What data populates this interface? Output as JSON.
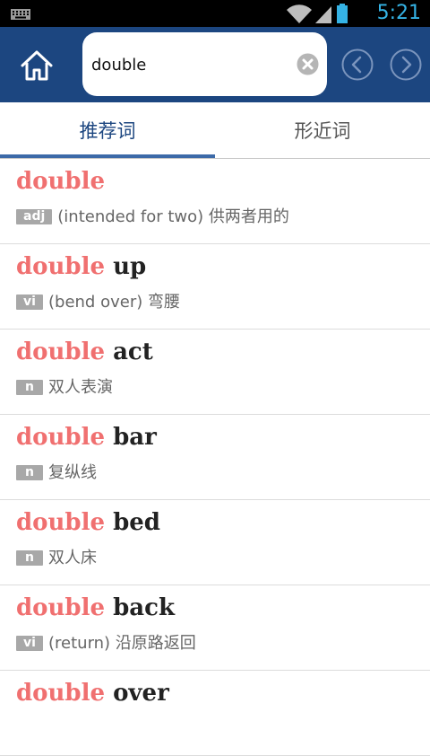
{
  "status_bar": {
    "time": "5:21",
    "icons": [
      "keyboard-icon",
      "wifi-icon",
      "signal-icon",
      "battery-icon"
    ]
  },
  "toolbar": {
    "search_value": "double",
    "home_icon": "home-icon",
    "clear_icon": "clear-icon",
    "back_icon": "arrow-left-icon",
    "forward_icon": "arrow-right-icon",
    "background_color": "#1c4680"
  },
  "tabs": [
    {
      "label": "推荐词",
      "active": true
    },
    {
      "label": "形近词",
      "active": false
    }
  ],
  "results": [
    {
      "highlight": "double",
      "rest": "",
      "pos": "adj",
      "definition": "(intended for two) 供两者用的"
    },
    {
      "highlight": "double",
      "rest": " up",
      "pos": "vi",
      "definition": "(bend over) 弯腰"
    },
    {
      "highlight": "double",
      "rest": " act",
      "pos": "n",
      "definition": "双人表演"
    },
    {
      "highlight": "double",
      "rest": " bar",
      "pos": "n",
      "definition": "复纵线"
    },
    {
      "highlight": "double",
      "rest": " bed",
      "pos": "n",
      "definition": "双人床"
    },
    {
      "highlight": "double",
      "rest": " back",
      "pos": "vi",
      "definition": "(return) 沿原路返回"
    },
    {
      "highlight": "double",
      "rest": " over",
      "pos": "",
      "definition": ""
    }
  ],
  "colors": {
    "highlight": "#f07070",
    "accent": "#3c6aa8",
    "status_clock": "#35b3e5"
  }
}
